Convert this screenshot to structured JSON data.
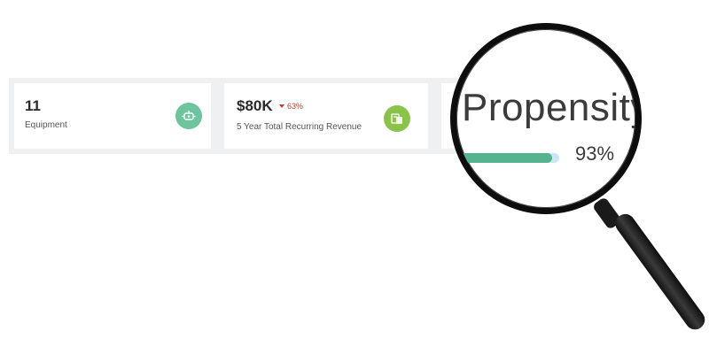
{
  "cards": [
    {
      "value": "11",
      "label": "Equipment",
      "icon": "equipment-icon",
      "icon_color": "#6cc59c"
    },
    {
      "value": "$80K",
      "delta": "63%",
      "delta_direction": "down",
      "delta_color": "#c0392b",
      "label": "5 Year Total Recurring Revenue",
      "icon": "revenue-icon",
      "icon_color": "#8bc34a"
    }
  ],
  "magnifier": {
    "title": "Propensity",
    "percent_text": "93%",
    "progress": 0.93,
    "bar_fill_color": "#55b38f",
    "bar_track_color": "#cfe4f6"
  }
}
